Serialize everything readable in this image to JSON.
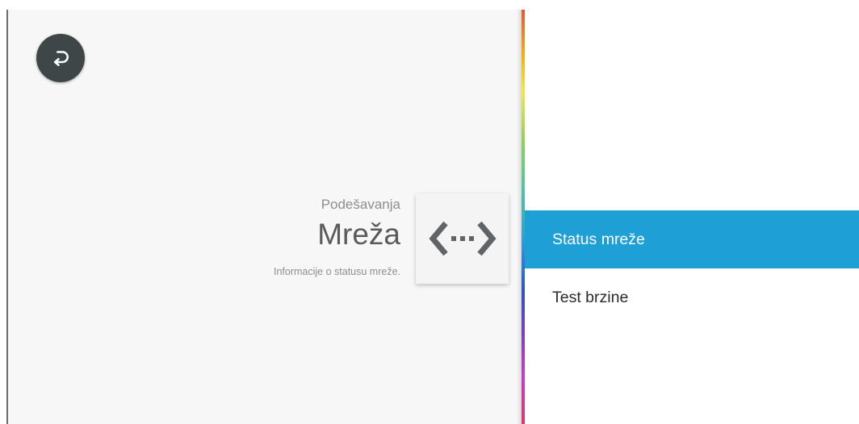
{
  "header": {
    "breadcrumb": "Podešavanja",
    "title": "Mreža",
    "description": "Informacije o statusu mreže."
  },
  "icons": {
    "back": "back-icon",
    "network": "network-icon"
  },
  "menu": {
    "items": [
      {
        "label": "Status mreže",
        "selected": true
      },
      {
        "label": "Test brzine",
        "selected": false
      }
    ]
  },
  "colors": {
    "accent": "#1ea0d7",
    "back_button": "#3f4648",
    "icon": "#5f6567"
  }
}
